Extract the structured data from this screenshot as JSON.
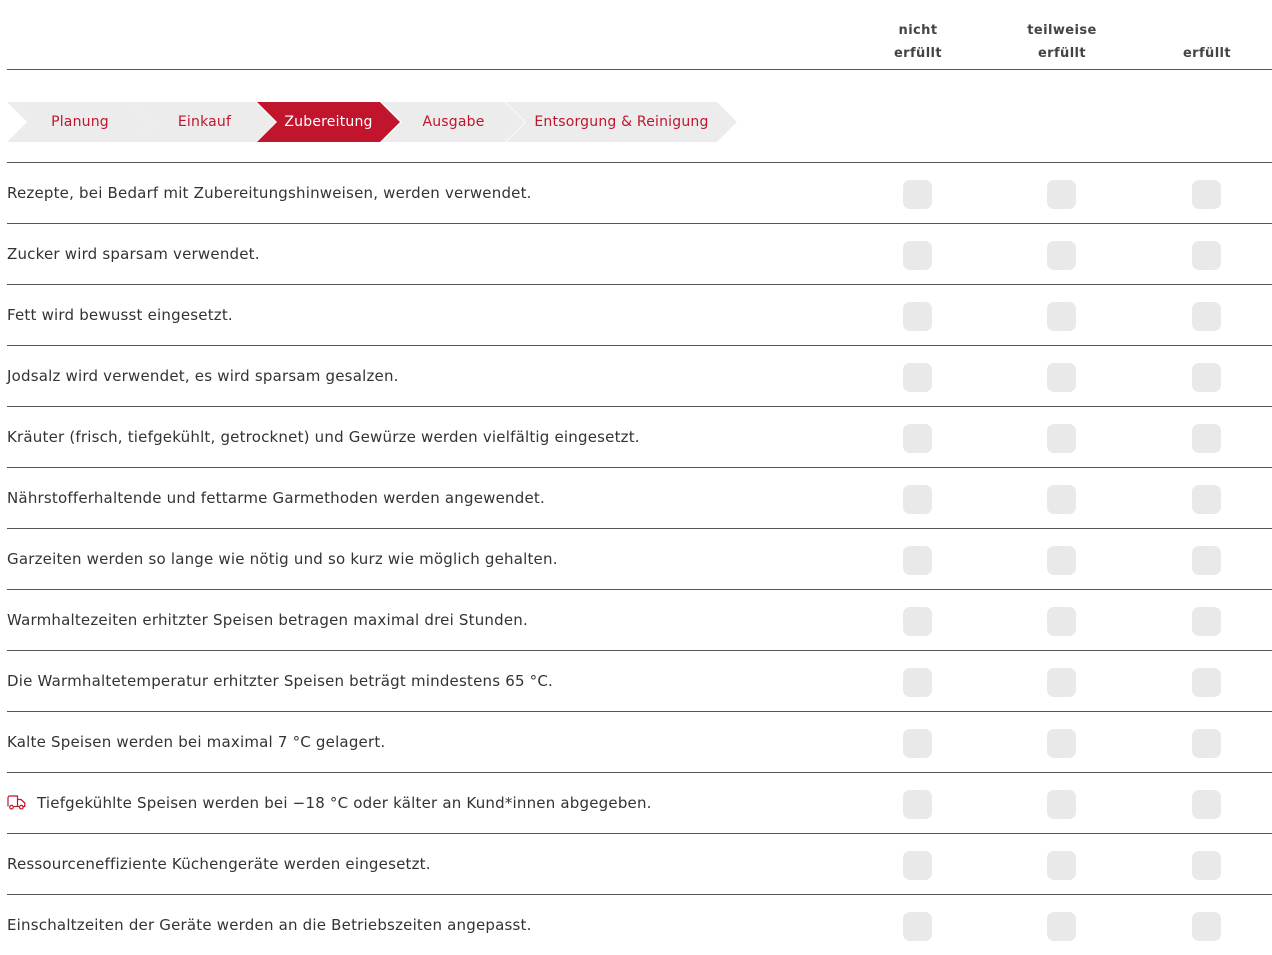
{
  "columns": [
    {
      "line1": "nicht",
      "line2": "erfüllt"
    },
    {
      "line1": "teilweise",
      "line2": "erfüllt"
    },
    {
      "line1": "",
      "line2": "erfüllt"
    }
  ],
  "steps": [
    {
      "label": "Planung",
      "active": false
    },
    {
      "label": "Einkauf",
      "active": false
    },
    {
      "label": "Zubereitung",
      "active": true
    },
    {
      "label": "Ausgabe",
      "active": false
    },
    {
      "label": "Entsorgung & Reinigung",
      "active": false
    }
  ],
  "colors": {
    "accent": "#c0152d",
    "step_bg": "#ececec",
    "checkbox_bg": "#e9e9e9",
    "rule": "#555555"
  },
  "criteria": [
    {
      "text": "Rezepte, bei Bedarf mit Zubereitungshinweisen, werden verwendet."
    },
    {
      "text": "Zucker wird sparsam verwendet."
    },
    {
      "text": "Fett wird bewusst eingesetzt."
    },
    {
      "text": "Jodsalz wird verwendet, es wird sparsam gesalzen."
    },
    {
      "text": "Kräuter (frisch, tiefgekühlt, getrocknet) und Gewürze werden vielfältig eingesetzt."
    },
    {
      "text": "Nährstofferhaltende und fettarme Garmethoden werden angewendet."
    },
    {
      "text": "Garzeiten werden so lange wie nötig und so kurz wie möglich gehalten."
    },
    {
      "text": "Warmhaltezeiten erhitzter Speisen betragen maximal drei Stunden."
    },
    {
      "text": "Die Warmhaltetemperatur erhitzter Speisen beträgt mindestens 65 °C."
    },
    {
      "text": "Kalte Speisen werden bei maximal 7 °C gelagert."
    },
    {
      "text": "Tiefgekühlte Speisen werden bei −18 °C oder kälter an Kund*innen abgegeben.",
      "icon": "delivery-truck-icon"
    },
    {
      "text": "Ressourceneffiziente Küchengeräte werden eingesetzt."
    },
    {
      "text": "Einschaltzeiten der Geräte werden an die Betriebszeiten angepasst."
    }
  ]
}
